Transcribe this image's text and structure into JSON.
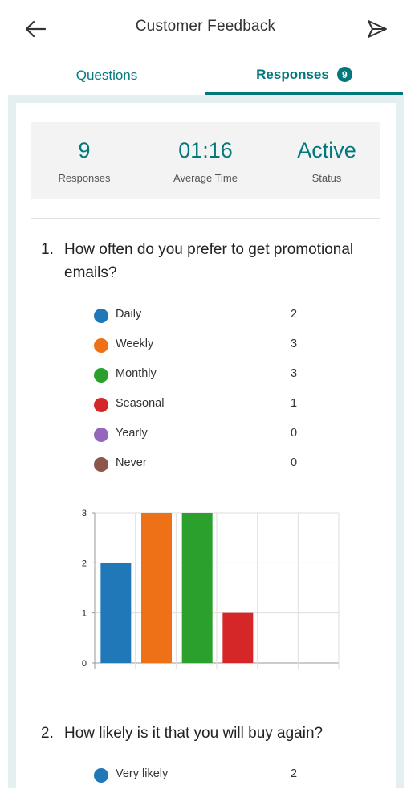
{
  "header": {
    "title": "Customer Feedback",
    "back_icon": "arrow-left-icon",
    "send_icon": "send-icon"
  },
  "tabs": [
    {
      "label": "Questions",
      "active": false
    },
    {
      "label": "Responses",
      "active": true,
      "badge": "9"
    }
  ],
  "summary": {
    "responses": {
      "value": "9",
      "label": "Responses"
    },
    "average_time": {
      "value": "01:16",
      "label": "Average Time"
    },
    "status": {
      "value": "Active",
      "label": "Status"
    }
  },
  "questions": [
    {
      "number": "1.",
      "text": "How often do you prefer to get promotional emails?",
      "options": [
        {
          "label": "Daily",
          "count": "2",
          "color": "#2178b8"
        },
        {
          "label": "Weekly",
          "count": "3",
          "color": "#ef7117"
        },
        {
          "label": "Monthly",
          "count": "3",
          "color": "#2ca02c"
        },
        {
          "label": "Seasonal",
          "count": "1",
          "color": "#d62728"
        },
        {
          "label": "Yearly",
          "count": "0",
          "color": "#9467bd"
        },
        {
          "label": "Never",
          "count": "0",
          "color": "#8c564b"
        }
      ]
    },
    {
      "number": "2.",
      "text": "How likely is it that you will buy again?",
      "options": [
        {
          "label": "Very likely",
          "count": "2",
          "color": "#2178b8"
        }
      ]
    }
  ],
  "colors": {
    "accent": "#03787c",
    "frame": "#e4eff1"
  },
  "chart_data": {
    "type": "bar",
    "categories": [
      "Daily",
      "Weekly",
      "Monthly",
      "Seasonal",
      "Yearly",
      "Never"
    ],
    "values": [
      2,
      3,
      3,
      1,
      0,
      0
    ],
    "colors": [
      "#2178b8",
      "#ef7117",
      "#2ca02c",
      "#d62728",
      "#9467bd",
      "#8c564b"
    ],
    "yticks": [
      "0",
      "1",
      "2",
      "3"
    ],
    "ylim": [
      0,
      3
    ],
    "grid": true,
    "legend": "none"
  }
}
